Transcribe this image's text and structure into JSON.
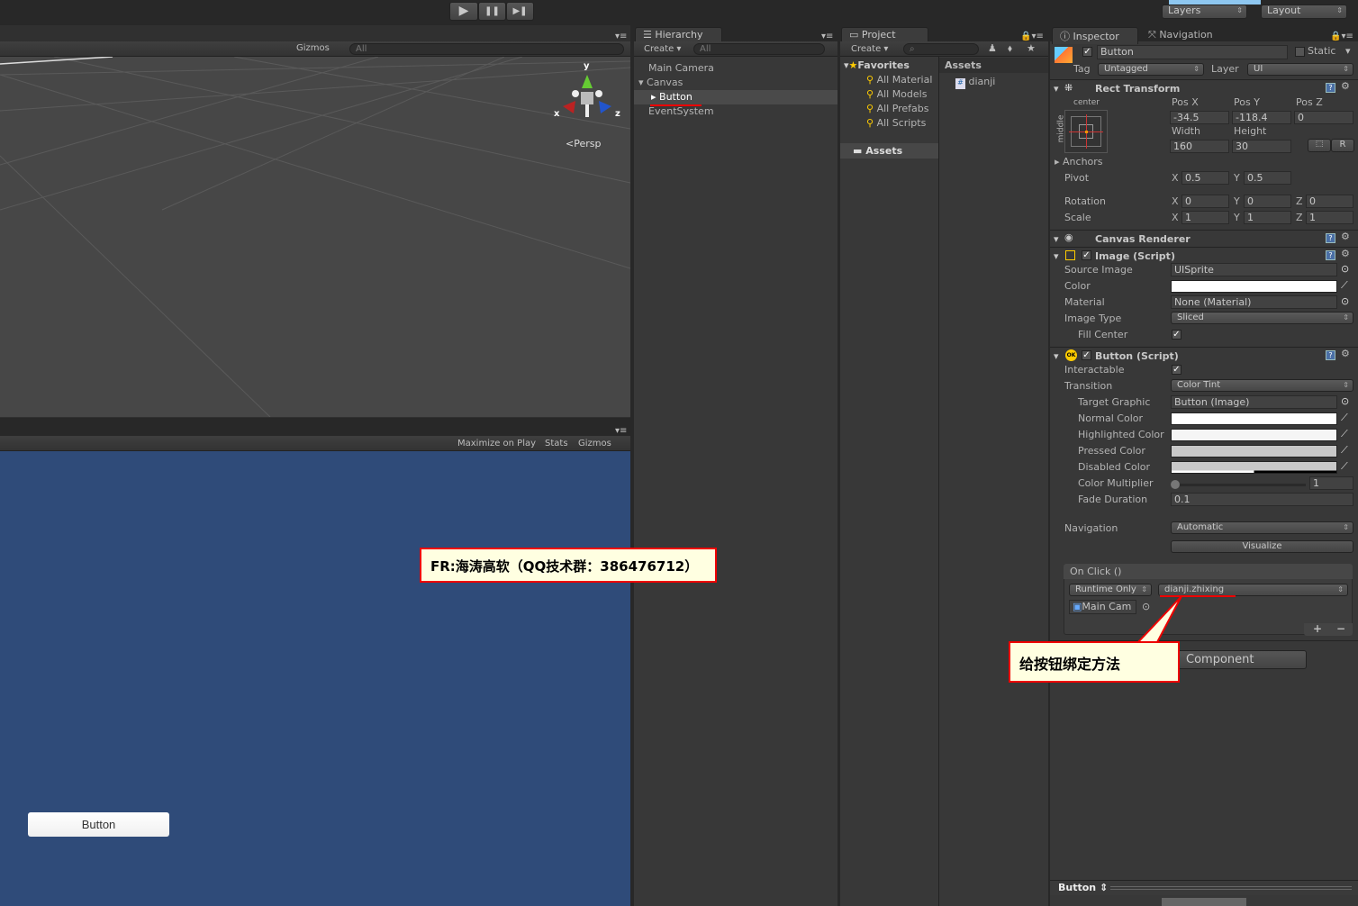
{
  "toolbar": {
    "play": "▶",
    "pause": "❚❚",
    "step": "▶❚",
    "layers": "Layers",
    "layout": "Layout"
  },
  "scene": {
    "gizmos": "Gizmos",
    "search_placeholder": "All",
    "persp": "Persp",
    "axis_x": "x",
    "axis_y": "y",
    "axis_z": "z"
  },
  "game": {
    "maximize": "Maximize on Play",
    "stats": "Stats",
    "gizmos": "Gizmos",
    "button_label": "Button",
    "bg_color": "#2f4b79"
  },
  "hierarchy": {
    "tab": "Hierarchy",
    "create": "Create",
    "search_placeholder": "All",
    "items": [
      "Main Camera",
      "Canvas",
      "Button",
      "EventSystem"
    ]
  },
  "project": {
    "tab": "Project",
    "create": "Create",
    "favorites": "Favorites",
    "fav_items": [
      "All Material",
      "All Models",
      "All Prefabs",
      "All Scripts"
    ],
    "assets_folder": "Assets",
    "assets_header": "Assets",
    "files": [
      "dianji"
    ]
  },
  "inspector": {
    "tab": "Inspector",
    "nav_tab": "Navigation",
    "object_name": "Button",
    "static": "Static",
    "tag_label": "Tag",
    "tag": "Untagged",
    "layer_label": "Layer",
    "layer": "UI",
    "rect": {
      "title": "Rect Transform",
      "anchor_h": "center",
      "anchor_v": "middle",
      "posx_l": "Pos X",
      "posy_l": "Pos Y",
      "posz_l": "Pos Z",
      "posx": "-34.5",
      "posy": "-118.4",
      "posz": "0",
      "width_l": "Width",
      "height_l": "Height",
      "width": "160",
      "height": "30",
      "r": "R",
      "anchors": "Anchors",
      "pivot": "Pivot",
      "pivot_x": "0.5",
      "pivot_y": "0.5",
      "rotation": "Rotation",
      "rot": [
        "0",
        "0",
        "0"
      ],
      "scale": "Scale",
      "scl": [
        "1",
        "1",
        "1"
      ],
      "x": "X",
      "y": "Y",
      "z": "Z"
    },
    "canvas_renderer": "Canvas Renderer",
    "image": {
      "title": "Image (Script)",
      "source_l": "Source Image",
      "source": "UISprite",
      "color_l": "Color",
      "material_l": "Material",
      "material": "None (Material)",
      "type_l": "Image Type",
      "type": "Sliced",
      "fill_l": "Fill Center"
    },
    "button": {
      "title": "Button (Script)",
      "interactable_l": "Interactable",
      "transition_l": "Transition",
      "transition": "Color Tint",
      "target_l": "Target Graphic",
      "target": "Button (Image)",
      "normal_l": "Normal Color",
      "highlight_l": "Highlighted Color",
      "pressed_l": "Pressed Color",
      "disabled_l": "Disabled Color",
      "multiplier_l": "Color Multiplier",
      "multiplier": "1",
      "fade_l": "Fade Duration",
      "fade": "0.1",
      "navigation_l": "Navigation",
      "navigation": "Automatic",
      "visualize": "Visualize",
      "onclick": "On Click ()",
      "runtime": "Runtime Only",
      "function": "dianji.zhixing",
      "object": "Main Cam",
      "plus": "+",
      "minus": "−"
    },
    "add_component": "Component",
    "preview": "Button"
  },
  "annotations": {
    "credit": "FR:海涛高软（QQ技术群：386476712）",
    "bind_note": "给按钮绑定方法"
  },
  "colors": {
    "normal": "#ffffff",
    "highlighted": "#f5f5f5",
    "pressed": "#c8c8c8",
    "disabled": "#c8c8c8"
  }
}
